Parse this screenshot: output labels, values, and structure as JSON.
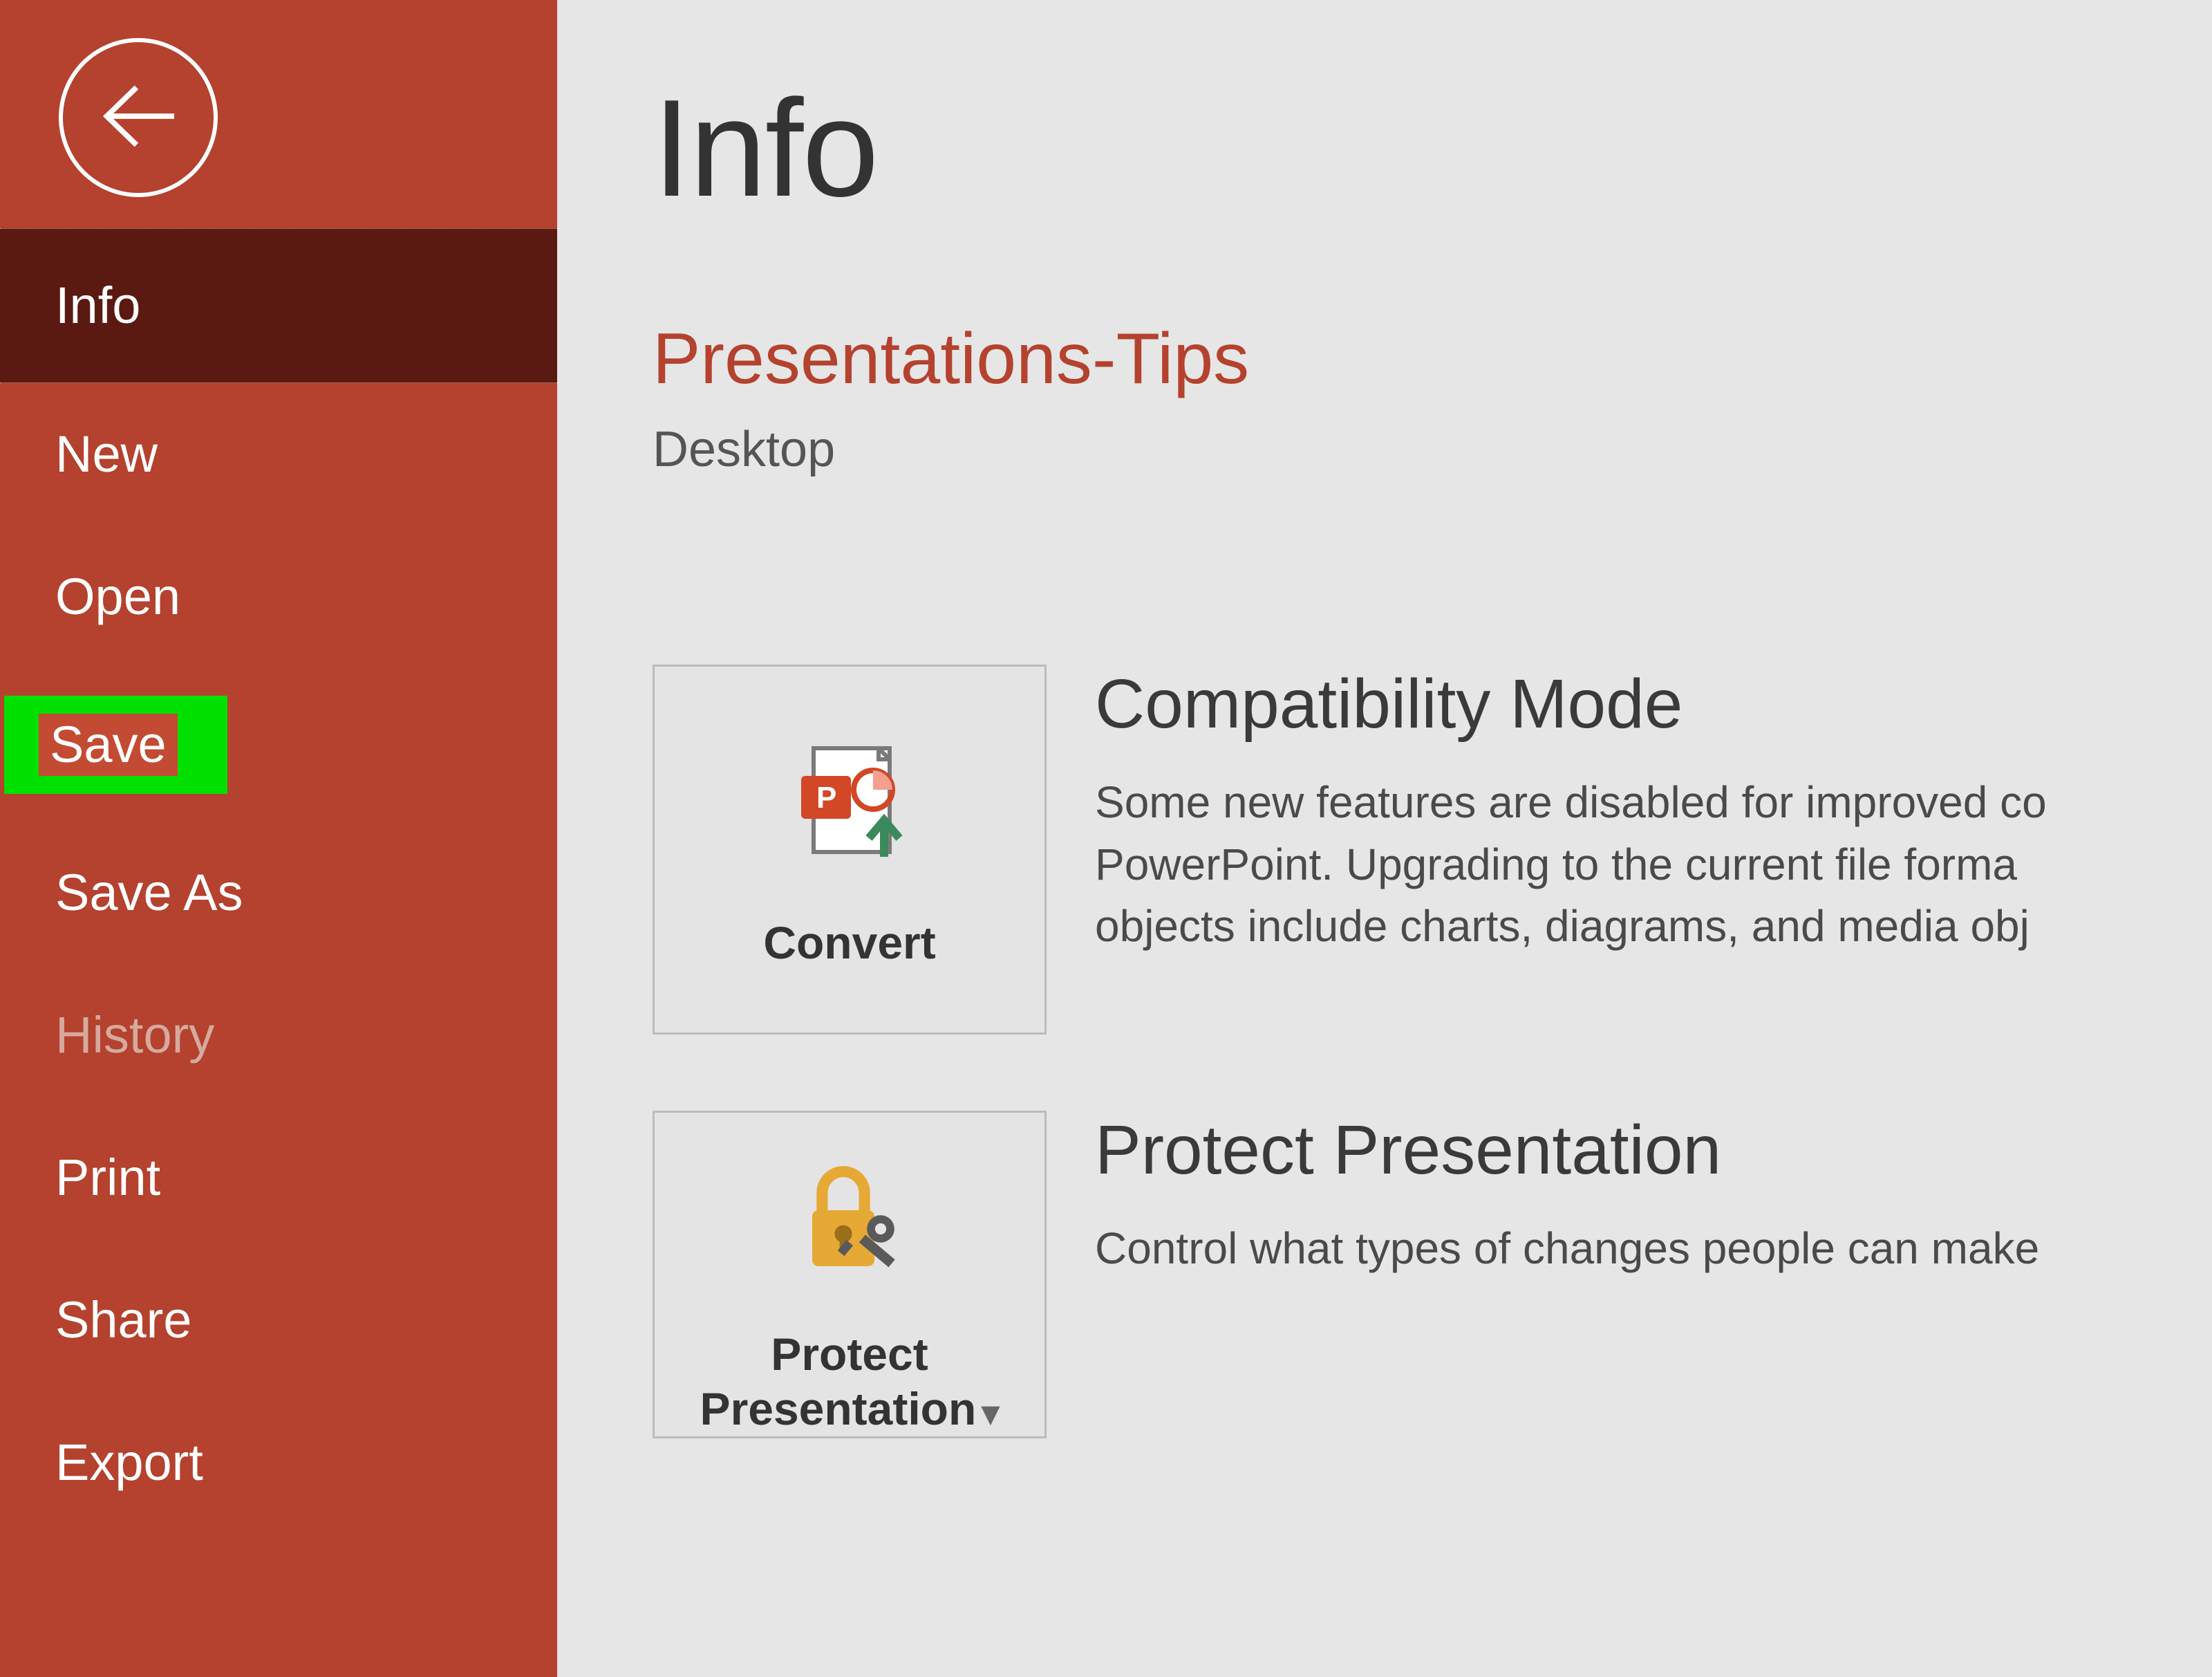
{
  "sidebar": {
    "items": [
      {
        "label": "Info",
        "state": "selected"
      },
      {
        "label": "New",
        "state": "normal"
      },
      {
        "label": "Open",
        "state": "normal"
      },
      {
        "label": "Save",
        "state": "highlighted"
      },
      {
        "label": "Save As",
        "state": "normal"
      },
      {
        "label": "History",
        "state": "disabled"
      },
      {
        "label": "Print",
        "state": "normal"
      },
      {
        "label": "Share",
        "state": "normal"
      },
      {
        "label": "Export",
        "state": "normal"
      }
    ]
  },
  "content": {
    "page_title": "Info",
    "document_title": "Presentations-Tips",
    "document_location": "Desktop",
    "sections": [
      {
        "tile_label": "Convert",
        "icon": "powerpoint-convert-icon",
        "heading": "Compatibility Mode",
        "body_lines": [
          "Some new features are disabled for improved co",
          "PowerPoint. Upgrading to the current file forma",
          "objects include charts, diagrams, and media obj"
        ]
      },
      {
        "tile_label": "Protect Presentation",
        "tile_dropdown": true,
        "icon": "lock-key-icon",
        "heading": "Protect Presentation",
        "body_lines": [
          "Control what types of changes people can make"
        ]
      }
    ]
  },
  "colors": {
    "brand": "#b4422e",
    "highlight": "#00e000"
  }
}
